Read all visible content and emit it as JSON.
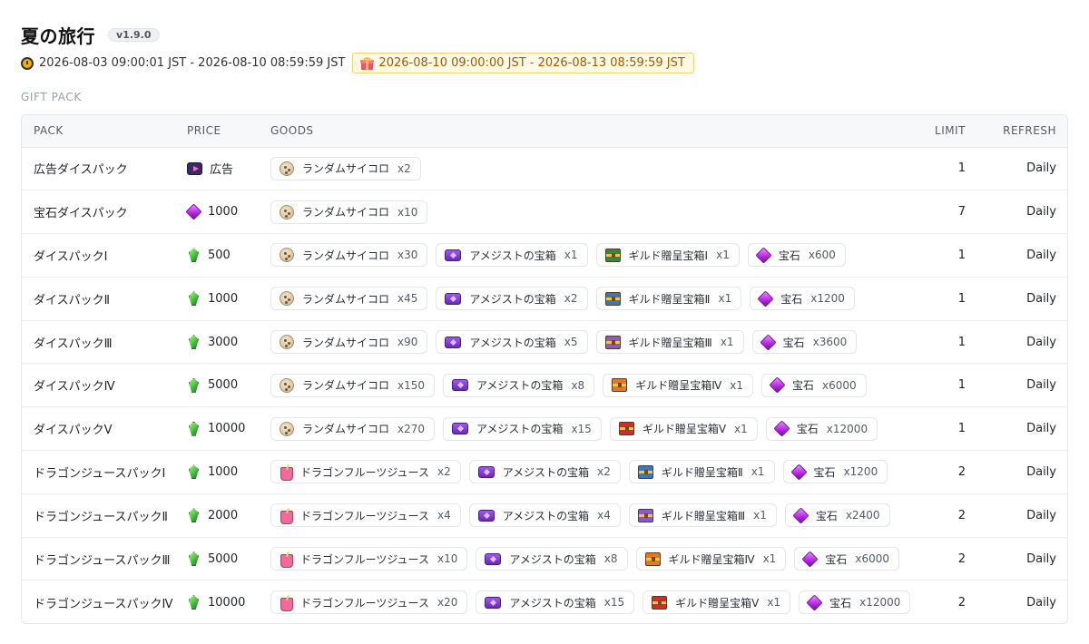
{
  "header": {
    "title": "夏の旅行",
    "version": "v1.9.0",
    "period": "2026-08-03 09:00:01 JST - 2026-08-10 08:59:59 JST",
    "bonus_period": "2026-08-10 09:00:00 JST - 2026-08-13 08:59:59 JST"
  },
  "section_label": "GIFT PACK",
  "columns": {
    "pack": "PACK",
    "price": "PRICE",
    "goods": "GOODS",
    "limit": "LIMIT",
    "refresh": "REFRESH"
  },
  "icon_colors": {
    "guild_1": "#2f8a4a",
    "guild_2": "#3a78b8",
    "guild_3": "#8a5ac8",
    "guild_4": "#e07a2a",
    "guild_5": "#c8302a"
  },
  "rows": [
    {
      "pack": "広告ダイスパック",
      "price": {
        "icon": "ad-icon",
        "value": "広告"
      },
      "goods": [
        {
          "icon": "dice-icon",
          "name": "ランダムサイコロ",
          "qty": "x2"
        }
      ],
      "limit": "1",
      "refresh": "Daily"
    },
    {
      "pack": "宝石ダイスパック",
      "price": {
        "icon": "gem-icon",
        "value": "1000"
      },
      "goods": [
        {
          "icon": "dice-icon",
          "name": "ランダムサイコロ",
          "qty": "x10"
        }
      ],
      "limit": "7",
      "refresh": "Daily"
    },
    {
      "pack": "ダイスパックⅠ",
      "price": {
        "icon": "crystal-icon",
        "value": "500"
      },
      "goods": [
        {
          "icon": "dice-icon",
          "name": "ランダムサイコロ",
          "qty": "x30"
        },
        {
          "icon": "amethyst-chest-icon",
          "name": "アメジストの宝箱",
          "qty": "x1"
        },
        {
          "icon": "guild-chest-1-icon",
          "name": "ギルド贈呈宝箱Ⅰ",
          "qty": "x1"
        },
        {
          "icon": "gem-icon",
          "name": "宝石",
          "qty": "x600"
        }
      ],
      "limit": "1",
      "refresh": "Daily"
    },
    {
      "pack": "ダイスパックⅡ",
      "price": {
        "icon": "crystal-icon",
        "value": "1000"
      },
      "goods": [
        {
          "icon": "dice-icon",
          "name": "ランダムサイコロ",
          "qty": "x45"
        },
        {
          "icon": "amethyst-chest-icon",
          "name": "アメジストの宝箱",
          "qty": "x2"
        },
        {
          "icon": "guild-chest-2-icon",
          "name": "ギルド贈呈宝箱Ⅱ",
          "qty": "x1"
        },
        {
          "icon": "gem-icon",
          "name": "宝石",
          "qty": "x1200"
        }
      ],
      "limit": "1",
      "refresh": "Daily"
    },
    {
      "pack": "ダイスパックⅢ",
      "price": {
        "icon": "crystal-icon",
        "value": "3000"
      },
      "goods": [
        {
          "icon": "dice-icon",
          "name": "ランダムサイコロ",
          "qty": "x90"
        },
        {
          "icon": "amethyst-chest-icon",
          "name": "アメジストの宝箱",
          "qty": "x5"
        },
        {
          "icon": "guild-chest-3-icon",
          "name": "ギルド贈呈宝箱Ⅲ",
          "qty": "x1"
        },
        {
          "icon": "gem-icon",
          "name": "宝石",
          "qty": "x3600"
        }
      ],
      "limit": "1",
      "refresh": "Daily"
    },
    {
      "pack": "ダイスパックⅣ",
      "price": {
        "icon": "crystal-icon",
        "value": "5000"
      },
      "goods": [
        {
          "icon": "dice-icon",
          "name": "ランダムサイコロ",
          "qty": "x150"
        },
        {
          "icon": "amethyst-chest-icon",
          "name": "アメジストの宝箱",
          "qty": "x8"
        },
        {
          "icon": "guild-chest-4-icon",
          "name": "ギルド贈呈宝箱Ⅳ",
          "qty": "x1"
        },
        {
          "icon": "gem-icon",
          "name": "宝石",
          "qty": "x6000"
        }
      ],
      "limit": "1",
      "refresh": "Daily"
    },
    {
      "pack": "ダイスパックⅤ",
      "price": {
        "icon": "crystal-icon",
        "value": "10000"
      },
      "goods": [
        {
          "icon": "dice-icon",
          "name": "ランダムサイコロ",
          "qty": "x270"
        },
        {
          "icon": "amethyst-chest-icon",
          "name": "アメジストの宝箱",
          "qty": "x15"
        },
        {
          "icon": "guild-chest-5-icon",
          "name": "ギルド贈呈宝箱Ⅴ",
          "qty": "x1"
        },
        {
          "icon": "gem-icon",
          "name": "宝石",
          "qty": "x12000"
        }
      ],
      "limit": "1",
      "refresh": "Daily"
    },
    {
      "pack": "ドラゴンジュースパックⅠ",
      "price": {
        "icon": "crystal-icon",
        "value": "1000"
      },
      "goods": [
        {
          "icon": "dragon-juice-icon",
          "name": "ドラゴンフルーツジュース",
          "qty": "x2"
        },
        {
          "icon": "amethyst-chest-icon",
          "name": "アメジストの宝箱",
          "qty": "x2"
        },
        {
          "icon": "guild-chest-2-icon",
          "name": "ギルド贈呈宝箱Ⅱ",
          "qty": "x1"
        },
        {
          "icon": "gem-icon",
          "name": "宝石",
          "qty": "x1200"
        }
      ],
      "limit": "2",
      "refresh": "Daily"
    },
    {
      "pack": "ドラゴンジュースパックⅡ",
      "price": {
        "icon": "crystal-icon",
        "value": "2000"
      },
      "goods": [
        {
          "icon": "dragon-juice-icon",
          "name": "ドラゴンフルーツジュース",
          "qty": "x4"
        },
        {
          "icon": "amethyst-chest-icon",
          "name": "アメジストの宝箱",
          "qty": "x4"
        },
        {
          "icon": "guild-chest-3-icon",
          "name": "ギルド贈呈宝箱Ⅲ",
          "qty": "x1"
        },
        {
          "icon": "gem-icon",
          "name": "宝石",
          "qty": "x2400"
        }
      ],
      "limit": "2",
      "refresh": "Daily"
    },
    {
      "pack": "ドラゴンジュースパックⅢ",
      "price": {
        "icon": "crystal-icon",
        "value": "5000"
      },
      "goods": [
        {
          "icon": "dragon-juice-icon",
          "name": "ドラゴンフルーツジュース",
          "qty": "x10"
        },
        {
          "icon": "amethyst-chest-icon",
          "name": "アメジストの宝箱",
          "qty": "x8"
        },
        {
          "icon": "guild-chest-4-icon",
          "name": "ギルド贈呈宝箱Ⅳ",
          "qty": "x1"
        },
        {
          "icon": "gem-icon",
          "name": "宝石",
          "qty": "x6000"
        }
      ],
      "limit": "2",
      "refresh": "Daily"
    },
    {
      "pack": "ドラゴンジュースパックⅣ",
      "price": {
        "icon": "crystal-icon",
        "value": "10000"
      },
      "goods": [
        {
          "icon": "dragon-juice-icon",
          "name": "ドラゴンフルーツジュース",
          "qty": "x20"
        },
        {
          "icon": "amethyst-chest-icon",
          "name": "アメジストの宝箱",
          "qty": "x15"
        },
        {
          "icon": "guild-chest-5-icon",
          "name": "ギルド贈呈宝箱Ⅴ",
          "qty": "x1"
        },
        {
          "icon": "gem-icon",
          "name": "宝石",
          "qty": "x12000"
        }
      ],
      "limit": "2",
      "refresh": "Daily"
    }
  ]
}
